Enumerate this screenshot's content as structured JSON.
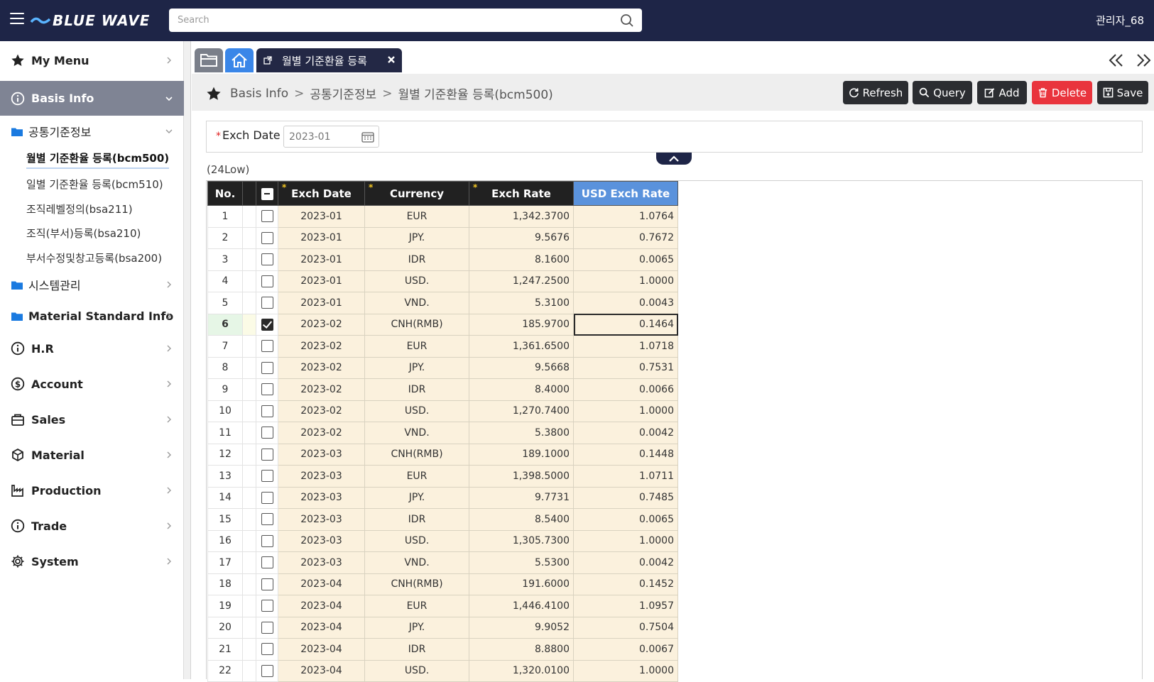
{
  "topbar": {
    "logo_text": "BLUE WAVE",
    "search_placeholder": "Search",
    "user": "관리자_68"
  },
  "sidebar": {
    "my_menu": "My Menu",
    "basis_info": "Basis Info",
    "folder_common": "공통기준정보",
    "leaves": [
      "월별 기준환율 등록(bcm500)",
      "일별 기준환율 등록(bcm510)",
      "조직레벨정의(bsa211)",
      "조직(부서)등록(bsa210)",
      "부서수정및창고등록(bsa200)"
    ],
    "folder_system": "시스템관리",
    "folder_material_std": "Material Standard Info",
    "items": [
      "H.R",
      "Account",
      "Sales",
      "Material",
      "Production",
      "Trade",
      "System"
    ]
  },
  "tabs": {
    "active_label": "월별 기준환율 등록"
  },
  "breadcrumb": {
    "root": "Basis Info",
    "sep": ">",
    "level1": "공통기준정보",
    "level2": "월별 기준환율 등록(bcm500)"
  },
  "toolbar": {
    "refresh": "Refresh",
    "query": "Query",
    "add": "Add",
    "delete": "Delete",
    "save": "Save"
  },
  "filter": {
    "required_mark": "*",
    "exch_date_label": "Exch Date",
    "exch_date_value": "2023-01"
  },
  "grid": {
    "row_count": "(24Low)",
    "headers": {
      "no": "No.",
      "exch_date": "Exch Date",
      "currency": "Currency",
      "exch_rate": "Exch Rate",
      "usd_rate": "USD Exch Rate",
      "required_mark": "*"
    },
    "selected_row": 6,
    "rows": [
      {
        "no": "1",
        "date": "2023-01",
        "currency": "EUR",
        "rate": "1,342.3700",
        "usd": "1.0764"
      },
      {
        "no": "2",
        "date": "2023-01",
        "currency": "JPY.",
        "rate": "9.5676",
        "usd": "0.7672"
      },
      {
        "no": "3",
        "date": "2023-01",
        "currency": "IDR",
        "rate": "8.1600",
        "usd": "0.0065"
      },
      {
        "no": "4",
        "date": "2023-01",
        "currency": "USD.",
        "rate": "1,247.2500",
        "usd": "1.0000"
      },
      {
        "no": "5",
        "date": "2023-01",
        "currency": "VND.",
        "rate": "5.3100",
        "usd": "0.0043"
      },
      {
        "no": "6",
        "date": "2023-02",
        "currency": "CNH(RMB)",
        "rate": "185.9700",
        "usd": "0.1464"
      },
      {
        "no": "7",
        "date": "2023-02",
        "currency": "EUR",
        "rate": "1,361.6500",
        "usd": "1.0718"
      },
      {
        "no": "8",
        "date": "2023-02",
        "currency": "JPY.",
        "rate": "9.5668",
        "usd": "0.7531"
      },
      {
        "no": "9",
        "date": "2023-02",
        "currency": "IDR",
        "rate": "8.4000",
        "usd": "0.0066"
      },
      {
        "no": "10",
        "date": "2023-02",
        "currency": "USD.",
        "rate": "1,270.7400",
        "usd": "1.0000"
      },
      {
        "no": "11",
        "date": "2023-02",
        "currency": "VND.",
        "rate": "5.3800",
        "usd": "0.0042"
      },
      {
        "no": "12",
        "date": "2023-03",
        "currency": "CNH(RMB)",
        "rate": "189.1000",
        "usd": "0.1448"
      },
      {
        "no": "13",
        "date": "2023-03",
        "currency": "EUR",
        "rate": "1,398.5000",
        "usd": "1.0711"
      },
      {
        "no": "14",
        "date": "2023-03",
        "currency": "JPY.",
        "rate": "9.7731",
        "usd": "0.7485"
      },
      {
        "no": "15",
        "date": "2023-03",
        "currency": "IDR",
        "rate": "8.5400",
        "usd": "0.0065"
      },
      {
        "no": "16",
        "date": "2023-03",
        "currency": "USD.",
        "rate": "1,305.7300",
        "usd": "1.0000"
      },
      {
        "no": "17",
        "date": "2023-03",
        "currency": "VND.",
        "rate": "5.5300",
        "usd": "0.0042"
      },
      {
        "no": "18",
        "date": "2023-04",
        "currency": "CNH(RMB)",
        "rate": "191.6000",
        "usd": "0.1452"
      },
      {
        "no": "19",
        "date": "2023-04",
        "currency": "EUR",
        "rate": "1,446.4100",
        "usd": "1.0957"
      },
      {
        "no": "20",
        "date": "2023-04",
        "currency": "JPY.",
        "rate": "9.9052",
        "usd": "0.7504"
      },
      {
        "no": "21",
        "date": "2023-04",
        "currency": "IDR",
        "rate": "8.8800",
        "usd": "0.0067"
      },
      {
        "no": "22",
        "date": "2023-04",
        "currency": "USD.",
        "rate": "1,320.0100",
        "usd": "1.0000"
      }
    ]
  }
}
